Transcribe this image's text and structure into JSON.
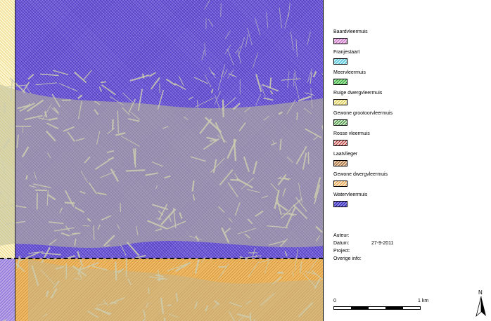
{
  "legend": {
    "items": [
      {
        "label": "Baardvleermuis",
        "fill": "#f2c8ee",
        "hatch": "#c36fc0"
      },
      {
        "label": "Franjestaart",
        "fill": "#bfeff7",
        "hatch": "#3fb6d2"
      },
      {
        "label": "Meervleermuis",
        "fill": "#a7e6a2",
        "hatch": "#2e9a3a"
      },
      {
        "label": "Ruige dwergvleermuis",
        "fill": "#fbf6c8",
        "hatch": "#d9c24a"
      },
      {
        "label": "Gewone grootoorvleermuis",
        "fill": "#cfeec8",
        "hatch": "#2c7a2c"
      },
      {
        "label": "Rosse vleermuis",
        "fill": "#f6d3d3",
        "hatch": "#b02a2a"
      },
      {
        "label": "Laatvlieger",
        "fill": "#f1d2b2",
        "hatch": "#8c5628"
      },
      {
        "label": "Gewone dwergvleermuis",
        "fill": "#fbe3c6",
        "hatch": "#e69a3a"
      },
      {
        "label": "Watervleermuis",
        "fill": "#8e86e8",
        "hatch": "#2a1fa8"
      }
    ]
  },
  "meta": {
    "author_label": "Auteur:",
    "author_value": "",
    "date_label": "Datum:",
    "date_value": "27-9-2011",
    "project_label": "Project:",
    "project_value": "",
    "other_label": "Overige info:",
    "other_value": ""
  },
  "scale": {
    "start_label": "0",
    "end_label": "1 km"
  },
  "north": {
    "label": "N"
  }
}
